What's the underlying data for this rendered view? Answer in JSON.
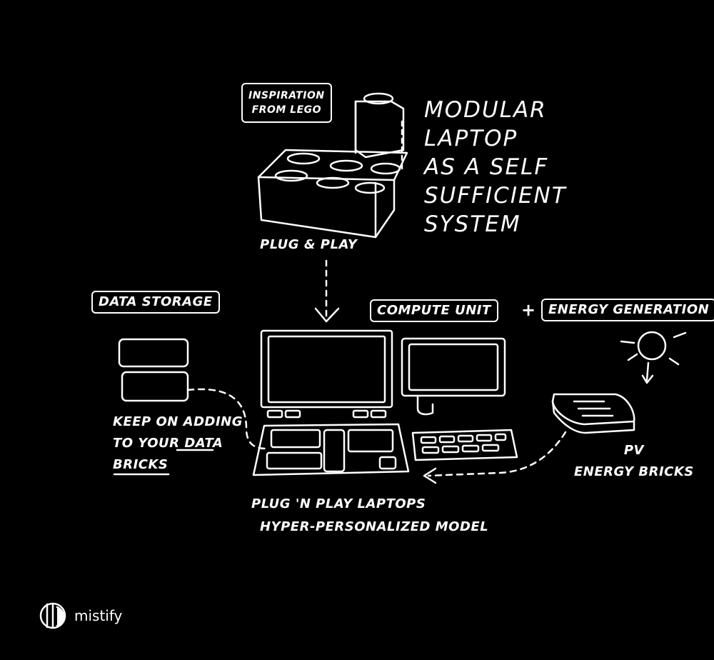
{
  "labels": {
    "inspiration_line1": "INSPIRATION",
    "inspiration_line2": "FROM LEGO",
    "title_line1": "MODULAR",
    "title_line2": "LAPTOP",
    "title_line3": "AS A SELF",
    "title_line4": "SUFFICIENT",
    "title_line5": "SYSTEM",
    "plug_and_play": "PLUG & PLAY",
    "data_storage": "DATA STORAGE",
    "compute_unit": "COMPUTE UNIT",
    "plus": "+",
    "energy_generation": "ENERGY GENERATION",
    "keep_line1": "KEEP ON ADDING",
    "keep_line2_a": "TO YOUR",
    "keep_line2_b": "DATA",
    "keep_line3": "BRICKS",
    "pv_line1": "PV",
    "pv_line2": "ENERGY BRICKS",
    "bottom_line1": "PLUG 'N PLAY LAPTOPS",
    "bottom_line2": "HYPER-PERSONALIZED MODEL"
  },
  "logo": {
    "text": "mistify"
  },
  "colors": {
    "background": "#000000",
    "ink": "#ffffff"
  }
}
